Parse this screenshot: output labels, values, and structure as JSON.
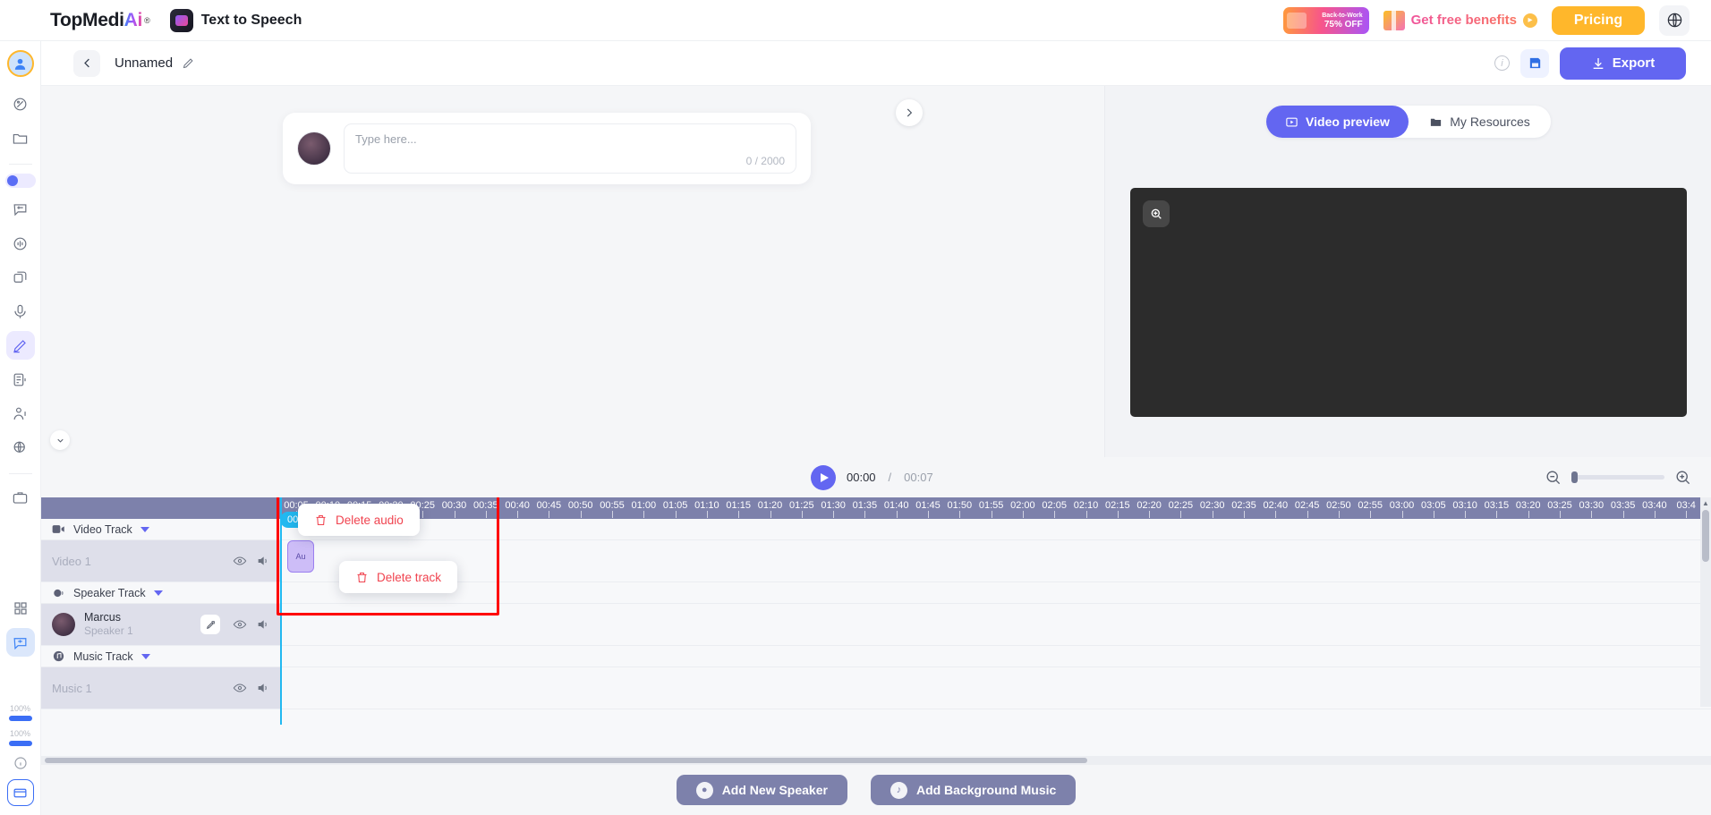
{
  "header": {
    "brand_prefix": "TopMedi",
    "brand_ai": "Ai",
    "brand_reg": "®",
    "product_name": "Text to Speech",
    "product_icon": "app-icon",
    "promo": {
      "line1": "Back-to-Work",
      "line2": "75% OFF"
    },
    "benefits_label": "Get free benefits",
    "benefits_arrow_icon": "chevron-right-icon",
    "pricing_label": "Pricing",
    "globe_icon": "globe-icon"
  },
  "project_bar": {
    "back_icon": "chevron-left-icon",
    "title": "Unnamed",
    "edit_icon": "pencil-icon",
    "info_icon": "info-icon",
    "save_icon": "save-icon",
    "export_label": "Export",
    "export_icon": "download-icon"
  },
  "sidebar": {
    "items": [
      {
        "name": "account-avatar",
        "icon": "user-avatar-icon"
      },
      {
        "name": "sidebar-item-ai-tools",
        "icon": "sparkle-badge-icon"
      },
      {
        "name": "sidebar-item-projects",
        "icon": "folder-icon"
      },
      {
        "name": "sidebar-item-toggle",
        "icon": "toggle-switch-icon"
      },
      {
        "name": "sidebar-item-text-to-speech",
        "icon": "speech-bubble-icon"
      },
      {
        "name": "sidebar-item-voice-changer",
        "icon": "waveform-circle-icon"
      },
      {
        "name": "sidebar-item-voice-cloning",
        "icon": "stacked-cards-icon"
      },
      {
        "name": "sidebar-item-recorder",
        "icon": "microphone-icon"
      },
      {
        "name": "sidebar-item-ai-writer",
        "icon": "pen-microphone-icon"
      },
      {
        "name": "sidebar-item-subtitles",
        "icon": "document-audio-icon"
      },
      {
        "name": "sidebar-item-speakers",
        "icon": "person-audio-icon"
      },
      {
        "name": "sidebar-item-translate",
        "icon": "globe-audio-icon"
      },
      {
        "name": "sidebar-item-workspace",
        "icon": "briefcase-icon"
      },
      {
        "name": "sidebar-item-apps",
        "icon": "grid-apps-icon"
      },
      {
        "name": "sidebar-item-support",
        "icon": "headset-chat-icon"
      }
    ],
    "quota": [
      {
        "label": "100%",
        "value": 100
      },
      {
        "label": "100%",
        "value": 100
      }
    ],
    "help_icon": "info-icon",
    "billing_icon": "credit-card-icon"
  },
  "script": {
    "avatar": "speaker-avatar",
    "placeholder": "Type here...",
    "value": "",
    "char_count": "0 / 2000",
    "next_icon": "chevron-right-icon",
    "collapse_icon": "chevron-down-icon"
  },
  "preview": {
    "tabs": [
      {
        "label": "Video preview",
        "icon": "video-icon",
        "active": true
      },
      {
        "label": "My Resources",
        "icon": "folder-icon",
        "active": false
      }
    ],
    "zoom_badge_icon": "zoom-in-icon"
  },
  "player": {
    "play_icon": "play-icon",
    "current_time": "00:00",
    "separator": "/",
    "total_time": "00:07",
    "zoom_out_icon": "zoom-out-icon",
    "zoom_in_icon": "zoom-in-icon",
    "zoom_value": 0
  },
  "timeline": {
    "playhead_label": "00:00",
    "ruler_ticks": [
      "00:05",
      "00:10",
      "00:15",
      "00:20",
      "00:25",
      "00:30",
      "00:35",
      "00:40",
      "00:45",
      "00:50",
      "00:55",
      "01:00",
      "01:05",
      "01:10",
      "01:15",
      "01:20",
      "01:25",
      "01:30",
      "01:35",
      "01:40",
      "01:45",
      "01:50",
      "01:55",
      "02:00",
      "02:05",
      "02:10",
      "02:15",
      "02:20",
      "02:25",
      "02:30",
      "02:35",
      "02:40",
      "02:45",
      "02:50",
      "02:55",
      "03:00",
      "03:05",
      "03:10",
      "03:15",
      "03:20",
      "03:25",
      "03:30",
      "03:35",
      "03:40",
      "03:4"
    ],
    "tracks": [
      {
        "header_label": "Video Track",
        "header_icon": "video-camera-icon",
        "row_name": "Video 1",
        "row_type": "plain",
        "eye_icon": "eye-icon",
        "volume_icon": "volume-icon"
      },
      {
        "header_label": "Speaker Track",
        "header_icon": "speaker-head-icon",
        "row_name": "Marcus",
        "row_sub": "Speaker 1",
        "row_type": "speaker",
        "edit_icon": "edit-square-icon",
        "eye_icon": "eye-icon",
        "volume_icon": "volume-icon"
      },
      {
        "header_label": "Music Track",
        "header_icon": "music-note-icon",
        "row_name": "Music 1",
        "row_type": "plain",
        "eye_icon": "eye-icon",
        "volume_icon": "volume-icon"
      }
    ],
    "audio_clip_label": "Au",
    "context_menu": [
      {
        "label": "Delete audio",
        "icon": "trash-icon"
      },
      {
        "label": "Delete track",
        "icon": "trash-icon"
      }
    ],
    "highlight_color": "#ff0000",
    "scroll_up_icon": "chevron-up-icon"
  },
  "bottom": {
    "add_speaker_label": "Add New Speaker",
    "add_speaker_icon": "speaker-head-icon",
    "add_music_label": "Add Background Music",
    "add_music_icon": "music-note-icon"
  },
  "colors": {
    "accent": "#6366f1",
    "ruler": "#7d81ab",
    "playhead": "#22b8f0",
    "danger": "#f0434f",
    "pricing": "#ffb72b"
  }
}
